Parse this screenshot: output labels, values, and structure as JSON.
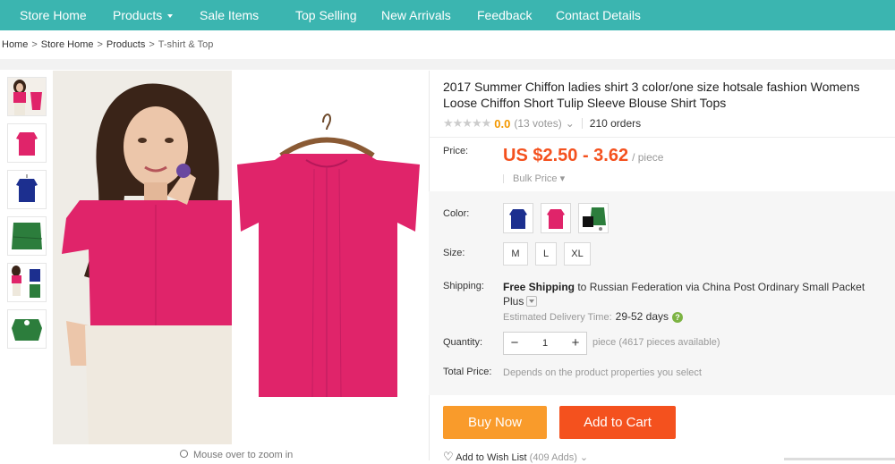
{
  "nav": {
    "items": [
      {
        "label": "Store Home"
      },
      {
        "label": "Products",
        "has_caret": true
      },
      {
        "label": "Sale Items"
      },
      {
        "label": "Top Selling"
      },
      {
        "label": "New Arrivals"
      },
      {
        "label": "Feedback"
      },
      {
        "label": "Contact Details"
      }
    ],
    "color": "#3bb5b0"
  },
  "breadcrumb": {
    "items": [
      "Home",
      "Store Home",
      "Products"
    ],
    "current": "T-shirt & Top",
    "separator": ">"
  },
  "gallery": {
    "thumbnails": [
      "model-in-pink-blouse",
      "pink-blouse",
      "blue-blouse",
      "green-blouse",
      "three-colors",
      "green-blouse-folded"
    ],
    "zoom_hint": "Mouse over to zoom in",
    "main_image": "model-and-pink-blouse"
  },
  "product": {
    "title": "2017 Summer Chiffon ladies shirt 3 color/one size hotsale fashion Womens Loose Chiffon Short Tulip Sleeve Blouse Shirt Tops",
    "stars": "★★★★★",
    "rating": "0.0",
    "votes": "(13 votes)",
    "orders": "210 orders"
  },
  "price": {
    "label": "Price:",
    "value": "US $2.50 - 3.62",
    "unit": "/ piece",
    "bulk_label": "Bulk Price"
  },
  "color": {
    "label": "Color:",
    "options": [
      {
        "name": "blue",
        "hex": "#1c2f8f"
      },
      {
        "name": "pink",
        "hex": "#e0246a"
      },
      {
        "name": "green",
        "hex": "#2c7d3c"
      }
    ]
  },
  "size": {
    "label": "Size:",
    "options": [
      "M",
      "L",
      "XL"
    ]
  },
  "shipping": {
    "label": "Shipping:",
    "free": "Free Shipping",
    "to": " to ",
    "destination": "Russian Federation via China Post Ordinary Small Packet Plus",
    "delivery_label": "Estimated Delivery Time:",
    "delivery_days": "29-52 days"
  },
  "quantity": {
    "label": "Quantity:",
    "value": "1",
    "minus": "−",
    "plus": "+",
    "availability": "piece (4617 pieces available)"
  },
  "total": {
    "label": "Total Price:",
    "text": "Depends on the product properties you select"
  },
  "actions": {
    "buy_now": "Buy Now",
    "add_to_cart": "Add to Cart",
    "wish": "Add to Wish List",
    "wish_adds": "(409 Adds)"
  },
  "colors": {
    "accent_orange": "#f4511e",
    "buy_now_orange": "#f99b2b",
    "price_orange": "#f4511e",
    "nav_teal": "#3bb5b0"
  }
}
